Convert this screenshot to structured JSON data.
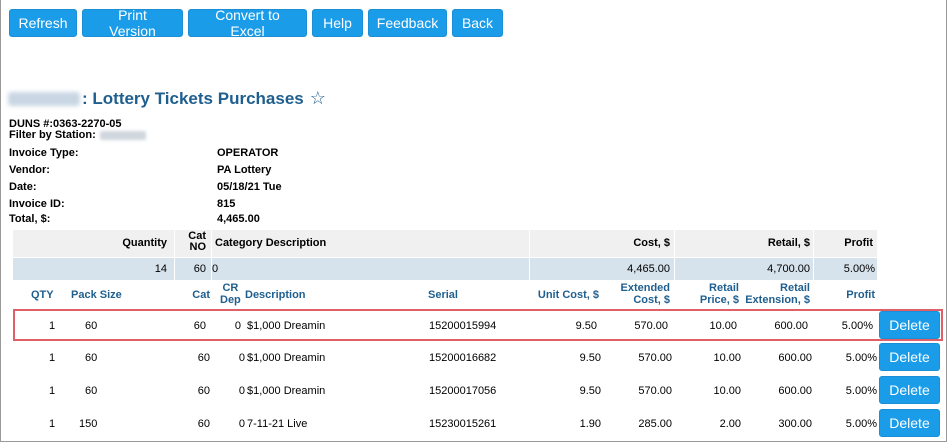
{
  "toolbar": {
    "buttons": [
      "Refresh",
      "Print Version",
      "Convert to Excel",
      "Help",
      "Feedback",
      "Back"
    ]
  },
  "page": {
    "title": ": Lottery Tickets Purchases",
    "duns": "DUNS #:0363-2270-05",
    "filter_label": "Filter by Station:"
  },
  "invoice": {
    "type_label": "Invoice Type:",
    "type_value": "OPERATOR",
    "vendor_label": "Vendor:",
    "vendor_value": "PA Lottery",
    "date_label": "Date:",
    "date_value": "05/18/21 Tue",
    "id_label": "Invoice ID:",
    "id_value": "815",
    "total_label": "Total, $:",
    "total_value": "4,465.00"
  },
  "summary": {
    "headers": {
      "quantity": "Quantity",
      "cat_no_1": "Cat",
      "cat_no_2": "NO",
      "category_description": "Category Description",
      "cost": "Cost, $",
      "retail": "Retail, $",
      "profit": "Profit"
    },
    "row": {
      "quantity": "14",
      "cat_no": "60",
      "category_description": "0",
      "cost": "4,465.00",
      "retail": "4,700.00",
      "profit": "5.00%"
    }
  },
  "columns": {
    "qty": "QTY",
    "pack_size": "Pack Size",
    "cat": "Cat",
    "cr_dep_1": "CR",
    "cr_dep_2": "Dep",
    "description": "Description",
    "serial": "Serial",
    "unit_cost": "Unit Cost, $",
    "ext_cost_1": "Extended",
    "ext_cost_2": "Cost, $",
    "retail_price_1": "Retail",
    "retail_price_2": "Price, $",
    "retail_ext_1": "Retail",
    "retail_ext_2": "Extension, $",
    "profit": "Profit"
  },
  "rows": [
    {
      "qty": "1",
      "pack_size": "60",
      "cat": "60",
      "cr_dep": "0",
      "description": "$1,000 Dreamin",
      "serial": "15200015994",
      "unit_cost": "9.50",
      "ext_cost": "570.00",
      "retail_price": "10.00",
      "retail_ext": "600.00",
      "profit": "5.00%",
      "action": "Delete"
    },
    {
      "qty": "1",
      "pack_size": "60",
      "cat": "60",
      "cr_dep": "0",
      "description": "$1,000 Dreamin",
      "serial": "15200016682",
      "unit_cost": "9.50",
      "ext_cost": "570.00",
      "retail_price": "10.00",
      "retail_ext": "600.00",
      "profit": "5.00%",
      "action": "Delete"
    },
    {
      "qty": "1",
      "pack_size": "60",
      "cat": "60",
      "cr_dep": "0",
      "description": "$1,000 Dreamin",
      "serial": "15200017056",
      "unit_cost": "9.50",
      "ext_cost": "570.00",
      "retail_price": "10.00",
      "retail_ext": "600.00",
      "profit": "5.00%",
      "action": "Delete"
    },
    {
      "qty": "1",
      "pack_size": "150",
      "cat": "60",
      "cr_dep": "0",
      "description": "7-11-21 Live",
      "serial": "15230015261",
      "unit_cost": "1.90",
      "ext_cost": "285.00",
      "retail_price": "2.00",
      "retail_ext": "300.00",
      "profit": "5.00%",
      "action": "Delete"
    }
  ],
  "colors": {
    "button": "#1a9ce8",
    "title": "#1f5f8f",
    "summary_row": "#d7e3ec",
    "highlight_border": "#e0606a"
  }
}
